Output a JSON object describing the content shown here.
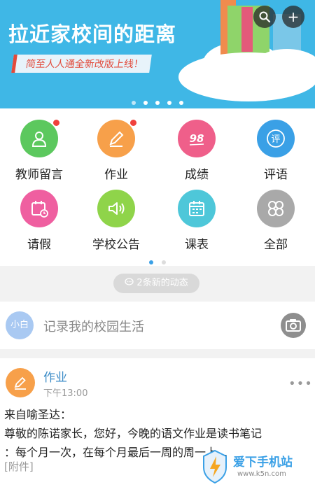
{
  "banner": {
    "title": "拉近家校间的距离",
    "subtitle": "简至人人通全新改版上线！",
    "search_glyph": "⚲",
    "add_glyph": "+"
  },
  "grid": {
    "items": [
      {
        "label": "教师留言",
        "color": "#5cc85e",
        "badge": true,
        "icon": "teacher-message-icon"
      },
      {
        "label": "作业",
        "color": "#f7a04a",
        "badge": true,
        "icon": "homework-pencil-icon"
      },
      {
        "label": "成绩",
        "color": "#ef5f8a",
        "badge": false,
        "icon": "score-98-icon",
        "icon_text": "98"
      },
      {
        "label": "评语",
        "color": "#3aa0e6",
        "badge": false,
        "icon": "comment-icon",
        "icon_text": "评"
      },
      {
        "label": "请假",
        "color": "#ef5fa0",
        "badge": false,
        "icon": "leave-calendar-icon"
      },
      {
        "label": "学校公告",
        "color": "#8fd44a",
        "badge": false,
        "icon": "speaker-icon"
      },
      {
        "label": "课表",
        "color": "#4ec7d9",
        "badge": false,
        "icon": "timetable-icon"
      },
      {
        "label": "全部",
        "color": "#a9a9a9",
        "badge": false,
        "icon": "all-grid-icon"
      }
    ]
  },
  "updates": {
    "label": "2条新的动态"
  },
  "compose": {
    "avatar_text": "小白",
    "placeholder": "记录我的校园生活"
  },
  "feed": {
    "title": "作业",
    "time": "下午13:00",
    "more": "•••",
    "line1": "来自喻圣达：",
    "line2": "尊敬的陈诺家长，您好，今晚的语文作业是读书笔记",
    "line3": "：每个月一次，在每个月最后一周的周一上...",
    "attachment": "[附件]"
  },
  "watermark": {
    "name": "爱下手机站",
    "url": "www.k5n.com"
  }
}
